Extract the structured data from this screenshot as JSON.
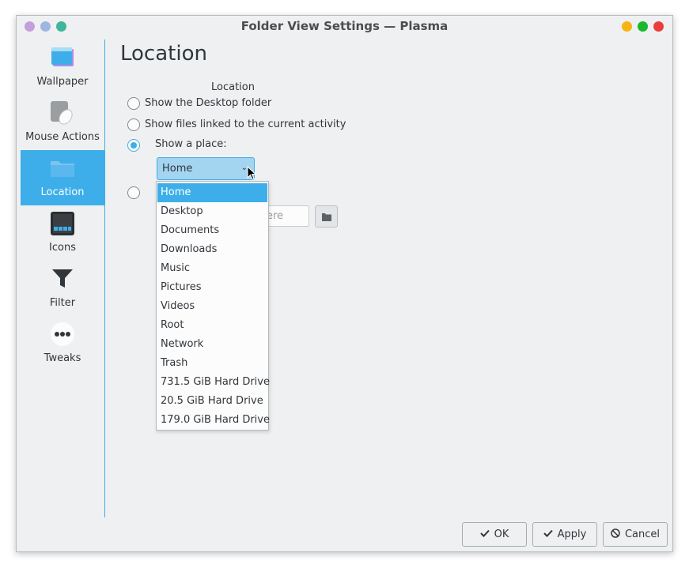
{
  "window": {
    "title": "Folder View Settings — Plasma",
    "left_dots": [
      "#c59fdc",
      "#9fb6e0",
      "#3fb59c"
    ],
    "right_dots": [
      "#f6b413",
      "#19b82f",
      "#ea3e3e"
    ]
  },
  "sidebar": {
    "items": [
      {
        "label": "Wallpaper",
        "icon": "wallpaper-icon",
        "active": false
      },
      {
        "label": "Mouse Actions",
        "icon": "mouse-icon",
        "active": false
      },
      {
        "label": "Location",
        "icon": "folder-icon",
        "active": true
      },
      {
        "label": "Icons",
        "icon": "icons-grid-icon",
        "active": false
      },
      {
        "label": "Filter",
        "icon": "filter-icon",
        "active": false
      },
      {
        "label": "Tweaks",
        "icon": "more-dots-icon",
        "active": false
      }
    ]
  },
  "main": {
    "page_title": "Location",
    "group_label": "Location",
    "options": [
      {
        "label": "Show the Desktop folder",
        "checked": false
      },
      {
        "label": "Show files linked to the current activity",
        "checked": false
      },
      {
        "label": "Show a place:",
        "checked": true
      },
      {
        "label": "",
        "checked": false
      }
    ],
    "place_combo_value": "Home",
    "path_field_placeholder": "ere",
    "places_dropdown": [
      "Home",
      "Desktop",
      "Documents",
      "Downloads",
      "Music",
      "Pictures",
      "Videos",
      "Root",
      "Network",
      "Trash",
      "731.5 GiB Hard Drive",
      "20.5 GiB Hard Drive",
      "179.0 GiB Hard Drive"
    ],
    "selected_place_index": 0
  },
  "buttons": {
    "ok": "OK",
    "apply": "Apply",
    "cancel": "Cancel"
  },
  "colors": {
    "accent": "#3daee9",
    "window_bg": "#eff0f1",
    "text": "#31363b"
  }
}
